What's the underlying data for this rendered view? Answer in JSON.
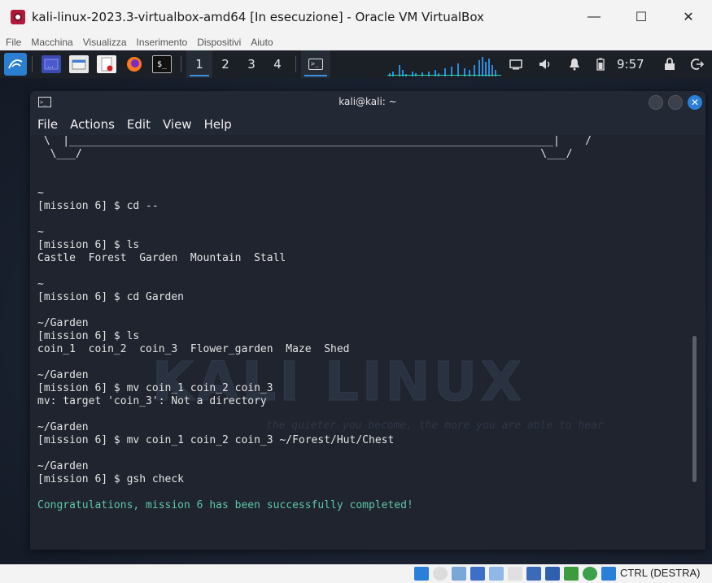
{
  "vbox": {
    "title": "kali-linux-2023.3-virtualbox-amd64 [In esecuzione] - Oracle VM VirtualBox",
    "menu": [
      "File",
      "Macchina",
      "Visualizza",
      "Inserimento",
      "Dispositivi",
      "Aiuto"
    ],
    "window_controls": {
      "minimize": "—",
      "maximize": "☐",
      "close": "✕"
    },
    "status": {
      "host_key": "CTRL (DESTRA)"
    }
  },
  "panel": {
    "workspaces": [
      "1",
      "2",
      "3",
      "4"
    ],
    "active_workspace": "1",
    "clock": "9:57",
    "icons": [
      "kali-menu-icon",
      "desktop-icon",
      "file-manager-icon",
      "text-editor-icon",
      "firefox-icon",
      "terminal-icon",
      "network-icon",
      "volume-icon",
      "notifications-icon",
      "battery-icon",
      "lock-icon",
      "logout-icon"
    ]
  },
  "terminal": {
    "title": "kali@kali: ~",
    "menu": [
      "File",
      "Actions",
      "Edit",
      "View",
      "Help"
    ],
    "close_glyph": "✕",
    "lines": [
      " \\  |____________________________________________________________________________|    /",
      "  \\___/                                                                        \\___/",
      "",
      "",
      "~",
      "[mission 6] $ cd --",
      "",
      "~",
      "[mission 6] $ ls",
      "Castle  Forest  Garden  Mountain  Stall",
      "",
      "~",
      "[mission 6] $ cd Garden",
      "",
      "~/Garden",
      "[mission 6] $ ls",
      "coin_1  coin_2  coin_3  Flower_garden  Maze  Shed",
      "",
      "~/Garden",
      "[mission 6] $ mv coin_1 coin_2 coin_3",
      "mv: target 'coin_3': Not a directory",
      "",
      "~/Garden",
      "[mission 6] $ mv coin_1 coin_2 coin_3 ~/Forest/Hut/Chest",
      "",
      "~/Garden",
      "[mission 6] $ gsh check",
      "",
      "Congratulations, mission 6 has been successfully completed!"
    ],
    "watermark": "KALI LINUX",
    "watermark_sub": "the quieter you become, the more you are able to hear"
  },
  "colors": {
    "success": "#5fc7a8",
    "accent": "#2a7fd8",
    "panel_bg": "#1b1f26",
    "terminal_bg": "#1f242e"
  }
}
